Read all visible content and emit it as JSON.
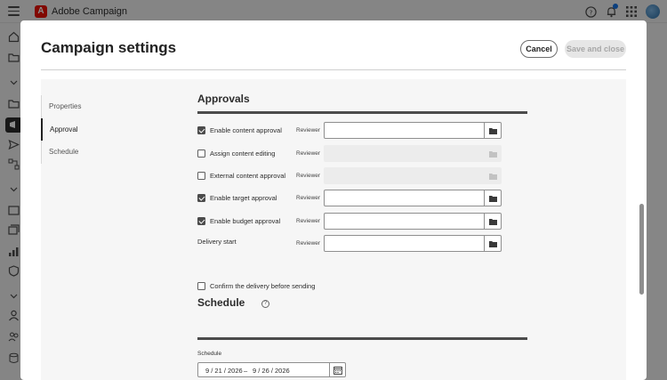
{
  "app": {
    "title": "Adobe Campaign",
    "logo_letter": "A",
    "brand_color": "#eb1000"
  },
  "topbar": {
    "icons": [
      "hamburger-icon",
      "help-icon",
      "bell-icon",
      "apps-grid-icon",
      "avatar"
    ]
  },
  "modal": {
    "title": "Campaign settings",
    "cancel_label": "Cancel",
    "save_label": "Save and close"
  },
  "tabs": [
    {
      "label": "Properties",
      "active": false
    },
    {
      "label": "Approval",
      "active": true
    },
    {
      "label": "Schedule",
      "active": false
    }
  ],
  "approvals": {
    "title": "Approvals",
    "reviewer_label": "Reviewer",
    "rows": [
      {
        "label": "Enable content approval",
        "checked": true,
        "disabled": false
      },
      {
        "label": "Assign content editing",
        "checked": false,
        "disabled": true
      },
      {
        "label": "External content approval",
        "checked": false,
        "disabled": true
      },
      {
        "label": "Enable target approval",
        "checked": true,
        "disabled": false
      },
      {
        "label": "Enable budget approval",
        "checked": true,
        "disabled": false
      }
    ],
    "delivery_start_label": "Delivery start",
    "confirm_label": "Confirm the delivery before sending",
    "confirm_checked": false
  },
  "schedule": {
    "title": "Schedule",
    "field_label": "Schedule",
    "start": "9 / 21 / 2026",
    "separator": "–",
    "end": "9 / 26 / 2026"
  }
}
